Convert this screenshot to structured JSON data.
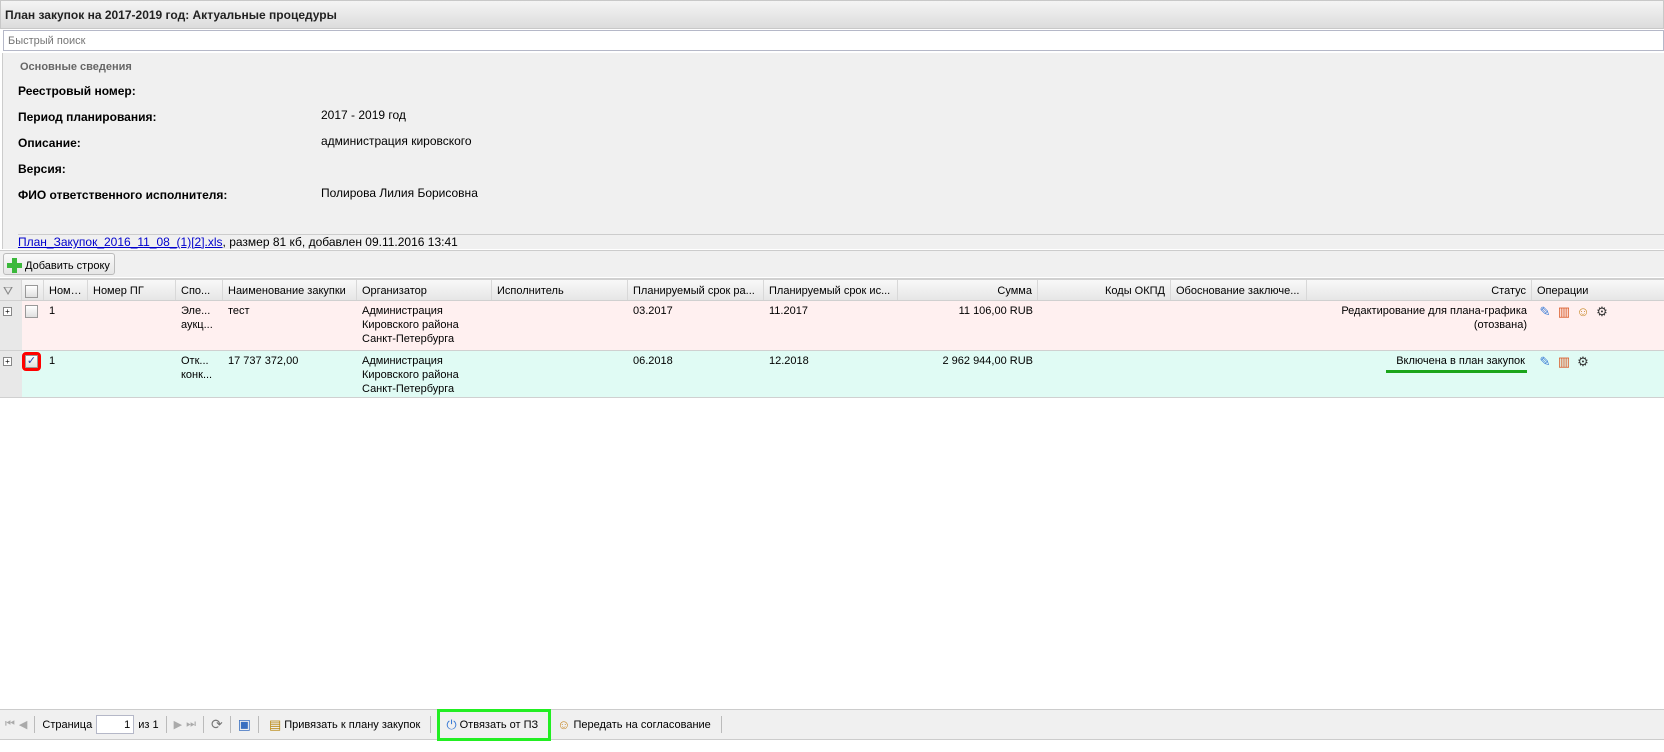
{
  "window": {
    "title": "План закупок на 2017-2019 год: Актуальные процедуры"
  },
  "search": {
    "placeholder": "Быстрый поиск"
  },
  "info": {
    "section_title": "Основные сведения",
    "fields": [
      {
        "label": "Реестровый номер:",
        "value": ""
      },
      {
        "label": "Период планирования:",
        "value": "2017 - 2019 год"
      },
      {
        "label": "Описание:",
        "value": "администрация кировского"
      },
      {
        "label": "Версия:",
        "value": ""
      },
      {
        "label": "ФИО ответственного исполнителя:",
        "value": "Полирова Лилия Борисовна"
      }
    ],
    "attachment": {
      "link": "План_Закупок_2016_11_08_(1)[2].xls",
      "details": ", размер 81 кб, добавлен 09.11.2016 13:41"
    }
  },
  "toolbar": {
    "add_row": "Добавить строку"
  },
  "grid": {
    "columns": [
      "Номер",
      "Номер ПГ",
      "Спо...",
      "Наименование закупки",
      "Организатор",
      "Исполнитель",
      "Планируемый срок ра...",
      "Планируемый срок ис...",
      "Сумма",
      "Коды ОКПД",
      "Обоснование заключе...",
      "Статус",
      "Операции"
    ],
    "rows": [
      {
        "number": "1",
        "pg": "",
        "method": "Эле... аукц...",
        "name": "тест",
        "organizer": "Администрация Кировского района Санкт-Петербурга",
        "executor": "",
        "start": "03.2017",
        "end": "11.2017",
        "sum": "11 106,00 RUB",
        "okpd": "",
        "reason": "",
        "status": "Редактирование для плана-графика (отозвана)",
        "checked": false
      },
      {
        "number": "1",
        "pg": "",
        "method": "Отк... конк...",
        "name": "17 737 372,00",
        "organizer": "Администрация Кировского района Санкт-Петербурга",
        "executor": "",
        "start": "06.2018",
        "end": "12.2018",
        "sum": "2 962 944,00 RUB",
        "okpd": "",
        "reason": "",
        "status": "Включена в план закупок",
        "checked": true
      }
    ]
  },
  "pager": {
    "page_label": "Страница",
    "page": "1",
    "of": "из 1"
  },
  "actions": {
    "bind": "Привязать к плану закупок",
    "unbind": "Отвязать от ПЗ",
    "send": "Передать на согласование"
  },
  "colors": {
    "highlight_red": "#ff0000",
    "highlight_green": "#22ee22",
    "status_underline": "#1aa51a",
    "row_pink": "#fff0f0",
    "row_green": "#e0fbf4"
  }
}
